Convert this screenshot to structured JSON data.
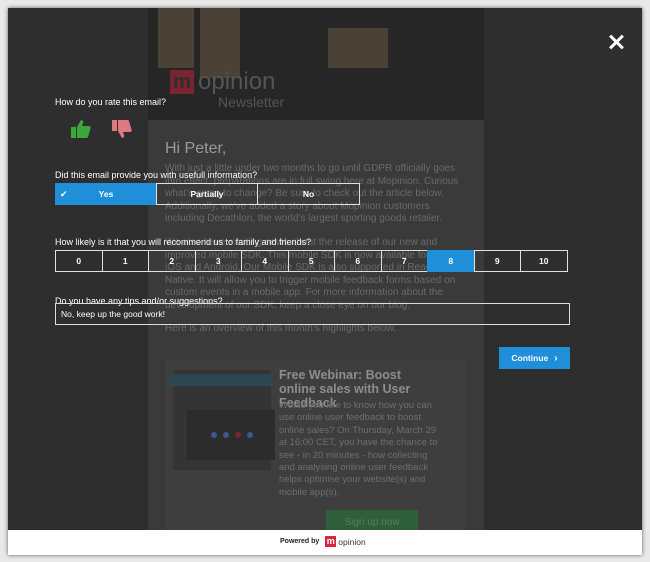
{
  "background": {
    "logo_mark": "m",
    "logo_text": "opinion",
    "logo_sub": "Newsletter",
    "greeting": "Hi Peter,",
    "paragraphs": [
      "With just a little under two months to go until GDPR officially goes into effect, preparations are in full swing here at Mopinion. Curious what's going to change? Be sure to check out the article below. Additionally, we've added a story about Mopinion customers including Decathlon, the world's largest sporting goods retailer.",
      "We also have exciting news about the release of our new and improved mobile SDK. This mobile SDK is now available for both iOS and Android. Our Mobile SDK is also supported in React Native. It will allow you to trigger mobile feedback forms based on custom events in a mobile app. For more information about the development of our SDK, keep a close eye on our blog.",
      "Here is an overview of this month's highlights below."
    ],
    "webinar_title": "Free Webinar: Boost online sales with User Feedback",
    "webinar_text": "Would you like to know how you can use online user feedback to boost online sales? On Thursday, March 29 at 16:00 CET, you have the chance to see - in 20 minutes - how collecting and analysing online user feedback helps optimise your website(s) and mobile app(s).",
    "card_ribbon": "SAVE YOUR SEAT",
    "signup_label": "Sign up now"
  },
  "survey": {
    "q1_label": "How do you rate this email?",
    "thumb_up_icon": "thumbs-up-icon",
    "thumb_down_icon": "thumbs-down-icon",
    "q2_label": "Did this email provide you with usefull information?",
    "q2_options": [
      "Yes",
      "Partially",
      "No"
    ],
    "q2_selected": "Yes",
    "q3_label": "How likely is it that you will recommend us to family and friends?",
    "q3_options": [
      "0",
      "1",
      "2",
      "3",
      "4",
      "5",
      "6",
      "7",
      "8",
      "9",
      "10"
    ],
    "q3_selected": "8",
    "q4_label": "Do you have any tips and/or suggestions?",
    "q4_value": "No, keep up the good work!",
    "continue_label": "Continue",
    "close_icon": "close-icon"
  },
  "footer": {
    "powered_by": "Powered by",
    "brand_mark": "m",
    "brand_name": "opinion"
  },
  "colors": {
    "accent": "#1e8fd8",
    "thumb_up": "#3aa83a",
    "thumb_down": "#e07a80",
    "brand": "#d9263f"
  }
}
